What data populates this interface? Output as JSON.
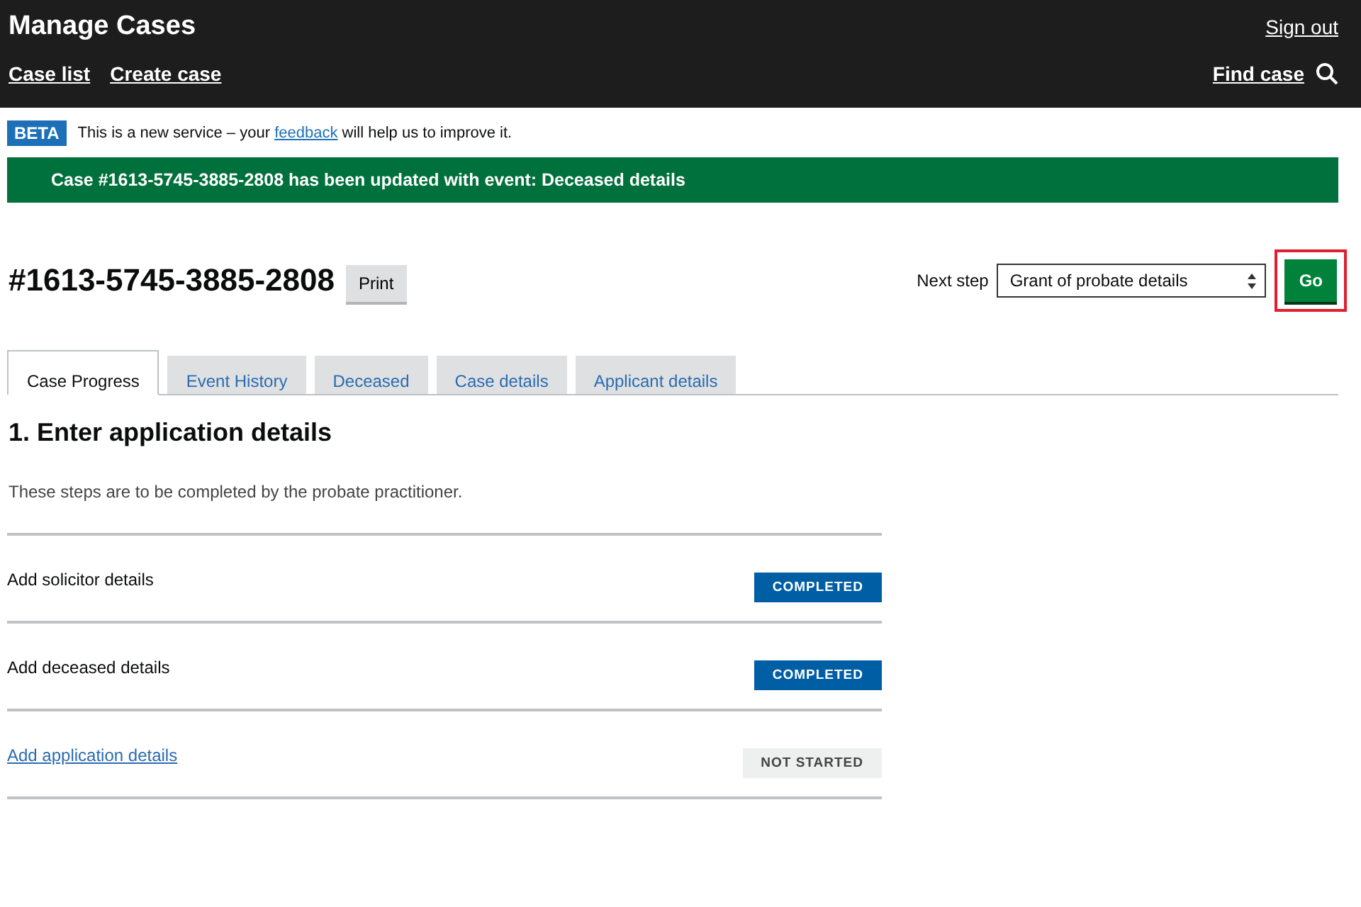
{
  "header": {
    "title": "Manage Cases",
    "sign_out": "Sign out",
    "nav": [
      {
        "label": "Case list"
      },
      {
        "label": "Create case"
      }
    ],
    "find_case": "Find case"
  },
  "phase_banner": {
    "tag": "BETA",
    "before": "This is a new service – your ",
    "link": "feedback",
    "after": " will help us to improve it."
  },
  "alert": "Case #1613-5745-3885-2808 has been updated with event: Deceased details",
  "case_number": "#1613-5745-3885-2808",
  "print_button": "Print",
  "next_step": {
    "label": "Next step",
    "value": "Grant of probate details",
    "go": "Go",
    "highlighted": true
  },
  "tabs": [
    {
      "label": "Case Progress",
      "selected": true
    },
    {
      "label": "Event History",
      "selected": false
    },
    {
      "label": "Deceased",
      "selected": false
    },
    {
      "label": "Case details",
      "selected": false
    },
    {
      "label": "Applicant details",
      "selected": false
    }
  ],
  "section": {
    "heading": "1. Enter application details",
    "description": "These steps are to be completed by the probate practitioner.",
    "steps": [
      {
        "name": "Add solicitor details",
        "link": false,
        "kind": "completed",
        "status_text": "COMPLETED"
      },
      {
        "name": "Add deceased details",
        "link": false,
        "kind": "completed",
        "status_text": "COMPLETED"
      },
      {
        "name": "Add application details",
        "link": true,
        "kind": "pending",
        "status_text": "NOT STARTED"
      }
    ]
  }
}
